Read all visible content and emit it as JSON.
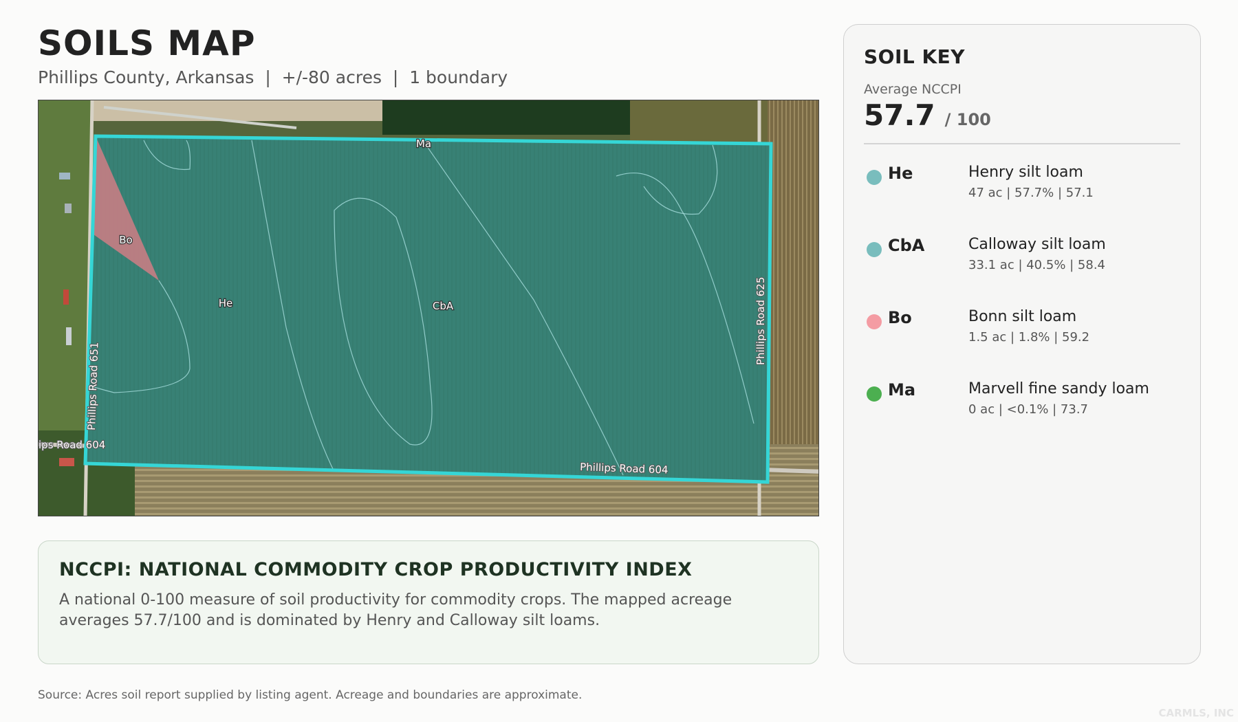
{
  "header": {
    "title": "SOILS MAP",
    "subtitle": "Phillips County, Arkansas  |  +/-80 acres  |  1 boundary"
  },
  "map": {
    "labels": {
      "he": "He",
      "cba": "CbA",
      "bo": "Bo",
      "ma": "Ma",
      "road_604_left": "ips Road 604",
      "road_604_bottom": "Phillips Road 604",
      "road_625": "Phillips Road 625",
      "road_651": "Phillips Road 651"
    },
    "colors": {
      "boundary": "#35d6d6",
      "he_fill": "#3f8f87",
      "bo_fill": "#c77d84"
    }
  },
  "info": {
    "title": "NCCPI: NATIONAL COMMODITY CROP PRODUCTIVITY INDEX",
    "body": "A national 0-100 measure of soil productivity for commodity crops. The mapped acreage averages 57.7/100 and is dominated by Henry and Calloway silt loams."
  },
  "source": "Source: Acres soil report supplied by listing agent. Acreage and boundaries are approximate.",
  "watermark": "CARMLS, INC",
  "soil_key": {
    "title": "SOIL KEY",
    "avg_label": "Average NCCPI",
    "avg_value": "57.7",
    "avg_max": "/ 100",
    "items": [
      {
        "symbol": "He",
        "name": "Henry silt loam",
        "stats": "47 ac | 57.7% | 57.1",
        "color": "#79bdbd"
      },
      {
        "symbol": "CbA",
        "name": "Calloway silt loam",
        "stats": "33.1 ac | 40.5% | 58.4",
        "color": "#79bdbd"
      },
      {
        "symbol": "Bo",
        "name": "Bonn silt loam",
        "stats": "1.5 ac | 1.8% | 59.2",
        "color": "#f49ca3"
      },
      {
        "symbol": "Ma",
        "name": "Marvell fine sandy loam",
        "stats": "0 ac | <0.1% | 73.7",
        "color": "#4caf50"
      }
    ]
  }
}
